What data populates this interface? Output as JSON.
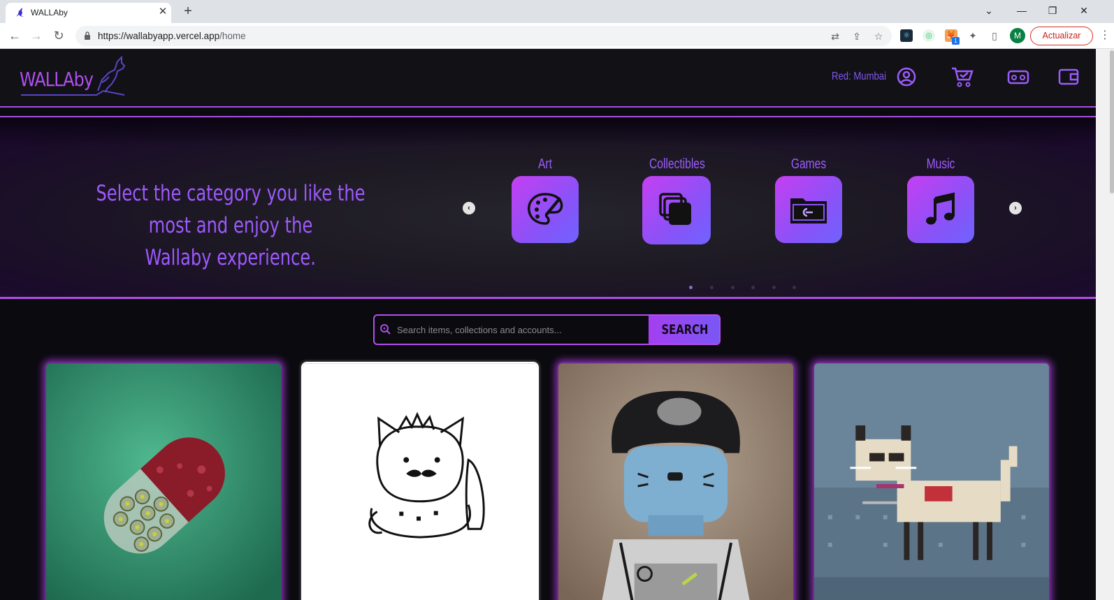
{
  "browser": {
    "tab_title": "WALLAby",
    "tab_close": "✕",
    "new_tab": "+",
    "url_host": "https://wallabyapp.vercel.app",
    "url_path": "/home",
    "update_button": "Actualizar",
    "profile_initial": "M",
    "extension_badge": "1"
  },
  "header": {
    "logo_text": "WALLAby",
    "network_label": "Red: Mumbai",
    "icons": [
      "account-icon",
      "cart-icon",
      "vr-headset-icon",
      "wallet-icon"
    ]
  },
  "hero": {
    "tagline_line1": "Select the category you like the most and enjoy the",
    "tagline_line2": "Wallaby experience.",
    "prev_arrow": "‹",
    "next_arrow": "›",
    "categories": [
      {
        "label": "Art",
        "icon": "palette-icon"
      },
      {
        "label": "Collectibles",
        "icon": "collection-icon"
      },
      {
        "label": "Games",
        "icon": "game-folder-icon"
      },
      {
        "label": "Music",
        "icon": "music-note-icon"
      }
    ],
    "pagination_count": 6,
    "active_page": 1
  },
  "search": {
    "placeholder": "Search items, collections and accounts...",
    "button_label": "SEARCH"
  },
  "colors": {
    "accent": "#a94ee5",
    "text_purple": "#9e59ff",
    "tile_gradient_start": "#c53ff2",
    "tile_gradient_end": "#6f63ff"
  },
  "cards": [
    {
      "name": "pill-nft-card",
      "subject": "capsule"
    },
    {
      "name": "mustache-cat-nft-card",
      "subject": "cat sketch"
    },
    {
      "name": "lego-cat-nft-card",
      "subject": "lego figure"
    },
    {
      "name": "pixel-cat-nft-card",
      "subject": "pixel cat"
    }
  ]
}
